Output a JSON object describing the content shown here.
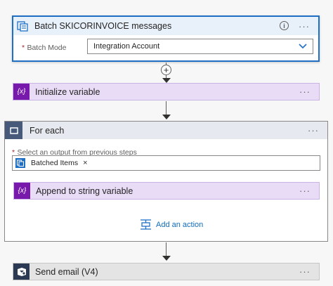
{
  "colors": {
    "batch_accent": "#1f6fc5",
    "variable_accent": "#7719aa",
    "variable_bg": "#e9dcf7",
    "foreach_accent": "#485a7a",
    "foreach_bg": "#e6e9ef",
    "email_accent": "#2b3a52",
    "email_bg": "#e4e4e4",
    "link": "#0f6cbd"
  },
  "batch": {
    "title": "Batch SKICORINVOICE messages",
    "icon": "batch-icon",
    "field_required": "*",
    "field_label": "Batch Mode",
    "field_value": "Integration Account",
    "more": "···",
    "info": "i"
  },
  "init_var": {
    "title": "Initialize variable",
    "icon_text": "{x}",
    "more": "···"
  },
  "foreach": {
    "title": "For each",
    "icon": "loop-icon",
    "more": "···",
    "field_required": "*",
    "field_label": "Select an output from previous steps",
    "token_label": "Batched Items",
    "token_remove": "×",
    "inner_action": {
      "title": "Append to string variable",
      "icon_text": "{x}",
      "more": "···"
    },
    "add_action": "Add an action"
  },
  "send_email": {
    "title": "Send email (V4)",
    "icon": "sendgrid-icon",
    "more": "···"
  },
  "connector": {
    "plus": "+"
  }
}
